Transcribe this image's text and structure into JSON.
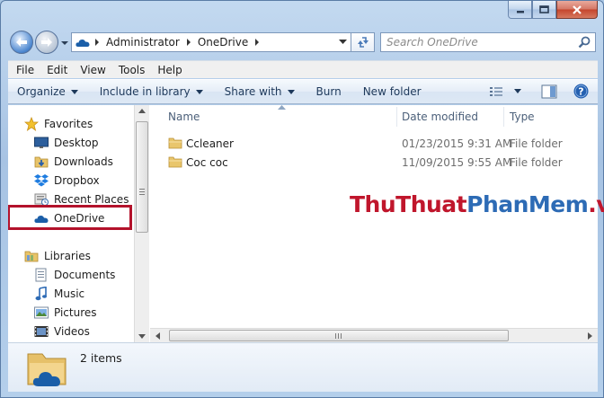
{
  "window": {
    "caption_buttons": [
      "minimize-icon",
      "maximize-icon",
      "close-icon"
    ]
  },
  "address_bar": {
    "root_icon": "onedrive-cloud-icon",
    "crumbs": [
      "Administrator",
      "OneDrive"
    ],
    "dropdown_icon": "chevron-down-icon",
    "refresh_icon": "refresh-icon"
  },
  "search": {
    "placeholder": "Search OneDrive",
    "icon": "search-icon"
  },
  "menu": {
    "items": [
      "File",
      "Edit",
      "View",
      "Tools",
      "Help"
    ]
  },
  "toolbar": {
    "organize": "Organize",
    "include_in_library": "Include in library",
    "share_with": "Share with",
    "burn": "Burn",
    "new_folder": "New folder",
    "view_icon": "view-options-icon",
    "preview_icon": "preview-pane-icon",
    "help_icon": "help-icon"
  },
  "nav": {
    "favorites": {
      "label": "Favorites",
      "icon": "star-icon",
      "items": [
        {
          "label": "Desktop",
          "icon": "desktop-icon"
        },
        {
          "label": "Downloads",
          "icon": "downloads-folder-icon"
        },
        {
          "label": "Dropbox",
          "icon": "dropbox-icon"
        },
        {
          "label": "Recent Places",
          "icon": "recent-places-icon"
        },
        {
          "label": "OneDrive",
          "icon": "onedrive-cloud-icon",
          "highlighted": true
        }
      ]
    },
    "libraries": {
      "label": "Libraries",
      "icon": "libraries-icon",
      "items": [
        {
          "label": "Documents",
          "icon": "documents-icon"
        },
        {
          "label": "Music",
          "icon": "music-icon"
        },
        {
          "label": "Pictures",
          "icon": "pictures-icon"
        },
        {
          "label": "Videos",
          "icon": "videos-icon"
        }
      ]
    }
  },
  "files": {
    "columns": [
      "Name",
      "Date modified",
      "Type"
    ],
    "rows": [
      {
        "name": "Ccleaner",
        "date": "01/23/2015 9:31 AM",
        "type": "File folder"
      },
      {
        "name": "Coc coc",
        "date": "11/09/2015 9:55 AM",
        "type": "File folder"
      }
    ]
  },
  "watermark": {
    "part1": "ThuThuat",
    "part2": "PhanMem",
    "part3": ".vn"
  },
  "details": {
    "count": "2 items",
    "icon": "onedrive-folder-icon"
  },
  "colors": {
    "accent_blue": "#2d6bb5",
    "highlight_red": "#b3122b",
    "watermark_red": "#c0162c"
  }
}
